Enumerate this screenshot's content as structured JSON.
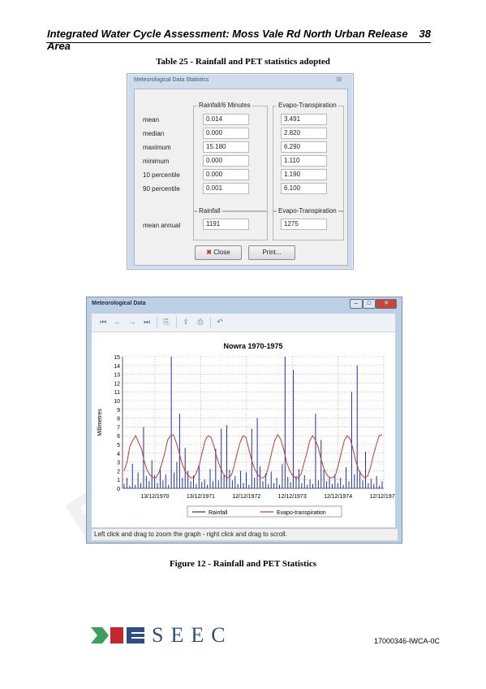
{
  "header": {
    "title": "Integrated Water Cycle Assessment: Moss Vale Rd North Urban Release Area",
    "page": "38"
  },
  "table_caption": "Table 25 - Rainfall and PET statistics adopted",
  "dialog": {
    "title": "Meteorological Data Statistics",
    "close_x": "⊠",
    "group1_rain": "Rainfall/6 Minutes",
    "group1_evap": "Evapo-Transpiration",
    "rows": [
      {
        "label": "mean",
        "rain": "0.014",
        "evap": "3.491"
      },
      {
        "label": "median",
        "rain": "0.000",
        "evap": "2.820"
      },
      {
        "label": "maximum",
        "rain": "15.180",
        "evap": "6.290"
      },
      {
        "label": "minimum",
        "rain": "0.000",
        "evap": "1.110"
      },
      {
        "label": "10 percentile",
        "rain": "0.000",
        "evap": "1.190"
      },
      {
        "label": "90 percentile",
        "rain": "0.001",
        "evap": "6.100"
      }
    ],
    "group2_rain": "Rainfall",
    "group2_evap": "Evapo-Transpiration",
    "annual_label": "mean annual",
    "annual_rain": "1191",
    "annual_evap": "1275",
    "close_btn": "Close",
    "print_btn": "Print..."
  },
  "window": {
    "title": "Meteorological Data",
    "status": "Left click and drag to zoom the graph - right click and drag to scroll."
  },
  "chart_data": {
    "type": "line",
    "title": "Nowra 1970-1975",
    "ylabel": "Millimetres",
    "xlabel": "",
    "ylim": [
      0,
      15
    ],
    "yticks": [
      "0",
      "1",
      "2",
      "3",
      "4",
      "5",
      "6",
      "7",
      "8",
      "9",
      "10",
      "11",
      "12",
      "13",
      "14",
      "15"
    ],
    "xticks": [
      "13/12/1970",
      "13/12/1971",
      "12/12/1972",
      "12/12/1973",
      "12/12/1974",
      "12/12/1975"
    ],
    "grid": true,
    "legend": "bottom",
    "series": [
      {
        "name": "Rainfall",
        "color": "#1f2f9e",
        "values": [
          0.5,
          1.2,
          0.3,
          2.8,
          0.4,
          1.8,
          0.6,
          7.0,
          1.4,
          0.8,
          3.2,
          1.5,
          0.6,
          2.4,
          0.9,
          1.6,
          0.4,
          15.0,
          1.8,
          3.0,
          8.5,
          1.2,
          4.6,
          2.0,
          0.8,
          1.5,
          0.5,
          2.6,
          0.7,
          1.0,
          0.4,
          2.2,
          0.8,
          4.5,
          0.9,
          6.8,
          1.5,
          7.2,
          2.1,
          0.9,
          1.4,
          0.5,
          2.0,
          0.6,
          1.8,
          0.4,
          6.8,
          1.2,
          8.0,
          2.5,
          0.8,
          1.7,
          0.5,
          1.9,
          0.6,
          1.2,
          0.4,
          2.8,
          15.0,
          1.3,
          0.7,
          13.5,
          1.4,
          2.2,
          0.6,
          1.5,
          0.4,
          1.0,
          0.5,
          8.5,
          0.9,
          5.5,
          2.1,
          0.8,
          1.3,
          0.5,
          1.6,
          0.6,
          1.2,
          0.4,
          2.4,
          0.8,
          11.0,
          1.6,
          14.0,
          2.0,
          0.9,
          4.2,
          0.6,
          1.1,
          0.5,
          1.4,
          0.3,
          0.8
        ]
      },
      {
        "name": "Evapo-transpiration",
        "color": "#c0392b",
        "values": [
          2.0,
          3.0,
          4.8,
          5.5,
          6.0,
          5.2,
          4.5,
          3.0,
          2.0,
          1.5,
          1.2,
          1.2,
          1.8,
          2.8,
          4.0,
          5.5,
          6.0,
          6.1,
          5.2,
          4.0,
          2.8,
          2.0,
          1.5,
          1.2,
          1.2,
          1.8,
          2.8,
          4.2,
          5.5,
          6.0,
          5.8,
          4.8,
          3.5,
          2.5,
          1.8,
          1.3,
          1.2,
          1.5,
          2.6,
          4.0,
          5.2,
          6.0,
          5.8,
          4.5,
          3.2,
          2.2,
          1.6,
          1.2,
          1.2,
          1.5,
          2.8,
          4.2,
          5.5,
          6.1,
          5.6,
          4.5,
          3.0,
          2.1,
          1.5,
          1.2,
          1.2,
          1.6,
          2.8,
          4.0,
          5.4,
          6.0,
          5.5,
          4.6,
          3.2,
          2.2,
          1.5,
          1.2,
          1.2,
          1.6,
          2.8,
          4.2,
          5.5,
          6.0,
          5.6,
          4.4,
          3.0,
          2.0,
          1.5,
          1.2,
          1.4,
          2.4,
          3.8,
          5.0,
          6.0,
          6.1
        ]
      }
    ]
  },
  "figure_caption": "Figure 12 - Rainfall and PET Statistics",
  "footer": {
    "logo_text": "SEEC",
    "code": "17000346-IWCA-0C"
  },
  "colors": {
    "logo_blue": "#2e4f86",
    "logo_green": "#3aa05a",
    "logo_red": "#c1272d"
  }
}
